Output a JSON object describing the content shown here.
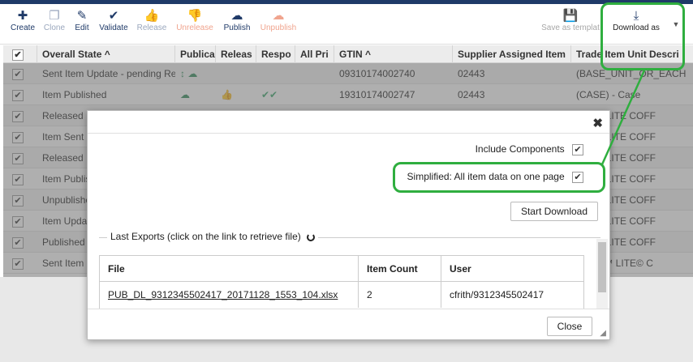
{
  "toolbar": {
    "buttons": [
      {
        "label": "Create",
        "icon": "plus-icon"
      },
      {
        "label": "Clone",
        "icon": "clone-icon"
      },
      {
        "label": "Edit",
        "icon": "pencil-icon"
      },
      {
        "label": "Validate",
        "icon": "check-icon"
      },
      {
        "label": "Release",
        "icon": "thumbs-up-icon"
      },
      {
        "label": "Unrelease",
        "icon": "thumbs-down-icon"
      },
      {
        "label": "Publish",
        "icon": "cloud-upload-icon"
      },
      {
        "label": "Unpublish",
        "icon": "cloud-upload-icon"
      },
      {
        "label": "Save as templat",
        "icon": "save-icon"
      },
      {
        "label": "Download as",
        "icon": "download-icon"
      }
    ]
  },
  "grid": {
    "columns": [
      "Overall State",
      "Publica",
      "Releas",
      "Respo",
      "All Pri",
      "GTIN",
      "Supplier Assigned Item",
      "Trade Item Unit Descri"
    ],
    "rows": [
      {
        "state": "Sent Item Update - pending Re",
        "gtin": "09310174002740",
        "supplier": "02443",
        "desc": "(BASE_UNIT_OR_EACH"
      },
      {
        "state": "Item Published",
        "gtin": "19310174002747",
        "supplier": "02443",
        "desc": "(CASE) - Case"
      },
      {
        "state": "Released",
        "gtin": "",
        "supplier": "",
        "desc": "APPO LITE COFF"
      },
      {
        "state": "Item Sent",
        "gtin": "",
        "supplier": "",
        "desc": "APPO LITE COFF"
      },
      {
        "state": "Released",
        "gtin": "",
        "supplier": "",
        "desc": "APPO LITE COFF"
      },
      {
        "state": "Item Publis",
        "gtin": "",
        "supplier": "",
        "desc": "APPO LITE COFF"
      },
      {
        "state": "Unpublishe",
        "gtin": "",
        "supplier": "",
        "desc": "APPO LITE COFF"
      },
      {
        "state": "Item Upda",
        "gtin": "",
        "supplier": "",
        "desc": "APPO LITE COFF"
      },
      {
        "state": "Published",
        "gtin": "",
        "supplier": "",
        "desc": "APPO LITE COFF"
      },
      {
        "state": "Sent Item",
        "gtin": "",
        "supplier": "",
        "desc": "APPO™ LITE© C"
      }
    ]
  },
  "modal": {
    "close_glyph": "✖",
    "include_components": "Include Components",
    "simplified": "Simplified: All item data on one page",
    "start_download": "Start Download",
    "last_exports": "Last Exports (click on the link to retrieve file)",
    "table_headers": [
      "File",
      "Item Count",
      "User"
    ],
    "exports": [
      {
        "file": "PUB_DL_9312345502417_20171128_1553_104.xlsx",
        "count": "2",
        "user": "cfrith/9312345502417"
      }
    ],
    "close_button": "Close"
  },
  "colors": {
    "brand": "#1f3a68",
    "highlight": "#2fae3f",
    "release_red": "#f0a48e",
    "check_green": "#3aa66b"
  }
}
